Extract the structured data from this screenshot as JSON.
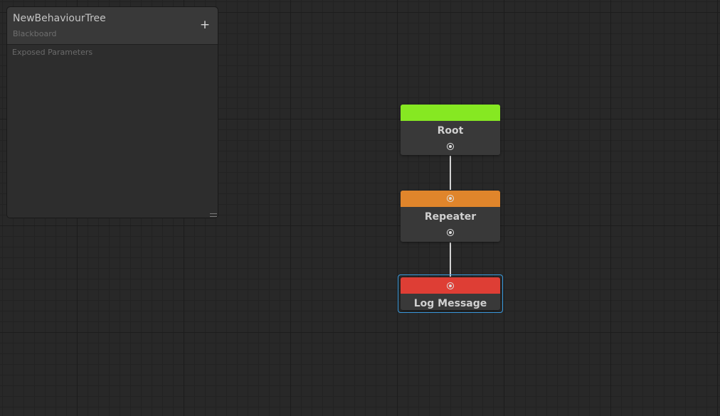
{
  "blackboard": {
    "title": "NewBehaviourTree",
    "subtitle": "Blackboard",
    "add_label": "+",
    "section_label": "Exposed Parameters"
  },
  "nodes": {
    "root": {
      "label": "Root",
      "color": "#86e822"
    },
    "repeater": {
      "label": "Repeater",
      "color": "#e0852b"
    },
    "log_message": {
      "label": "Log Message",
      "color": "#de3e35",
      "selected": true
    }
  },
  "colors": {
    "background": "#282828",
    "selection": "#3a9be0",
    "edge": "#d4d4d4"
  },
  "icons": {
    "port": "port-circle-icon",
    "add": "plus-icon",
    "resize": "resize-grip-icon"
  }
}
